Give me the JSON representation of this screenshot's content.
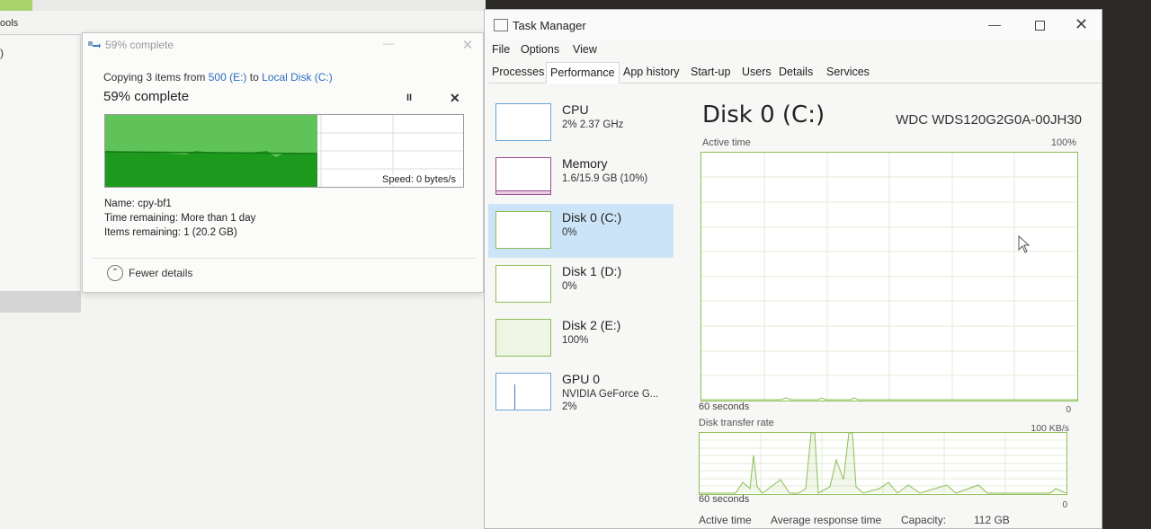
{
  "background": {
    "tools_label": "ools",
    "paren_label": ")"
  },
  "copy_dialog": {
    "title": "59% complete",
    "copying_prefix": "Copying 3 items from",
    "source": "500 (E:)",
    "to_word": "to",
    "destination": "Local Disk (C:)",
    "percent_label": "59% complete",
    "progress": 0.59,
    "speed": "Speed: 0 bytes/s",
    "name_label": "Name:",
    "name_value": "cpy-bf1",
    "time_label": "Time remaining:",
    "time_value": "More than 1 day",
    "items_label": "Items remaining:",
    "items_value": "1 (20.2 GB)",
    "fewer_details": "Fewer details",
    "pause_glyph": "II",
    "cancel_glyph": "✕",
    "min_glyph": "—",
    "close_glyph": "✕"
  },
  "task_manager": {
    "title": "Task Manager",
    "menu": [
      "File",
      "Options",
      "View"
    ],
    "tabs": [
      "Processes",
      "Performance",
      "App history",
      "Start-up",
      "Users",
      "Details",
      "Services"
    ],
    "active_tab": "Performance",
    "sidebar": [
      {
        "name": "CPU",
        "sub": "2% 2.37 GHz",
        "sub2": ""
      },
      {
        "name": "Memory",
        "sub": "1.6/15.9 GB (10%)",
        "sub2": ""
      },
      {
        "name": "Disk 0 (C:)",
        "sub": "0%",
        "sub2": ""
      },
      {
        "name": "Disk 1 (D:)",
        "sub": "0%",
        "sub2": ""
      },
      {
        "name": "Disk 2 (E:)",
        "sub": "100%",
        "sub2": ""
      },
      {
        "name": "GPU 0",
        "sub": "NVIDIA GeForce G...",
        "sub2": "2%"
      }
    ],
    "selected_item": "Disk 0 (C:)",
    "main": {
      "title": "Disk 0 (C:)",
      "model": "WDC WDS120G2G0A-00JH30",
      "active_time_label": "Active time",
      "active_time_max": "100%",
      "seconds_label": "60 seconds",
      "zero_label": "0",
      "transfer_label": "Disk transfer rate",
      "transfer_max": "100 KB/s",
      "seconds_label_2": "60 seconds",
      "zero_label_2": "0",
      "stats": {
        "active_time": "Active time",
        "avg_response": "Average response time",
        "capacity_label": "Capacity:",
        "capacity_value": "112 GB"
      }
    },
    "min_glyph": "—",
    "close_glyph": "✕"
  },
  "colors": {
    "progress_green": "#22a722",
    "disk_green": "#8cbf55",
    "selection_blue": "#cce4f7",
    "link_blue": "#2a6ebc"
  }
}
